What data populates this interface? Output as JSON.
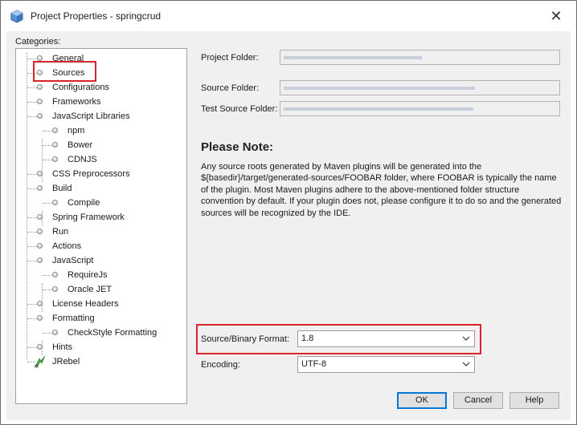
{
  "window": {
    "title": "Project Properties - springcrud"
  },
  "categories": {
    "label": "Categories:",
    "items": [
      {
        "label": "General"
      },
      {
        "label": "Sources"
      },
      {
        "label": "Configurations"
      },
      {
        "label": "Frameworks"
      },
      {
        "label": "JavaScript Libraries"
      },
      {
        "label": "npm"
      },
      {
        "label": "Bower"
      },
      {
        "label": "CDNJS"
      },
      {
        "label": "CSS Preprocessors"
      },
      {
        "label": "Build"
      },
      {
        "label": "Compile"
      },
      {
        "label": "Spring Framework"
      },
      {
        "label": "Run"
      },
      {
        "label": "Actions"
      },
      {
        "label": "JavaScript"
      },
      {
        "label": "RequireJs"
      },
      {
        "label": "Oracle JET"
      },
      {
        "label": "License Headers"
      },
      {
        "label": "Formatting"
      },
      {
        "label": "CheckStyle Formatting"
      },
      {
        "label": "Hints"
      },
      {
        "label": "JRebel"
      }
    ]
  },
  "form": {
    "project_folder_label": "Project Folder:",
    "source_folder_label": "Source Folder:",
    "test_source_folder_label": "Test Source Folder:"
  },
  "note": {
    "title": "Please Note:",
    "text": "Any source roots generated by Maven plugins will be generated into the ${basedir}/target/generated-sources/FOOBAR folder, where FOOBAR is typically the name of the plugin. Most Maven plugins adhere to the above-mentioned folder structure convention by default. If your plugin does not, please configure it to do so and the generated sources will be recognized by the IDE."
  },
  "format": {
    "source_binary_label": "Source/Binary Format:",
    "source_binary_value": "1.8",
    "encoding_label": "Encoding:",
    "encoding_value": "UTF-8"
  },
  "buttons": {
    "ok": "OK",
    "cancel": "Cancel",
    "help": "Help"
  },
  "colors": {
    "highlight": "#d9252a",
    "primary_border": "#0078d7",
    "dialog_bg": "#f0f0f0"
  }
}
